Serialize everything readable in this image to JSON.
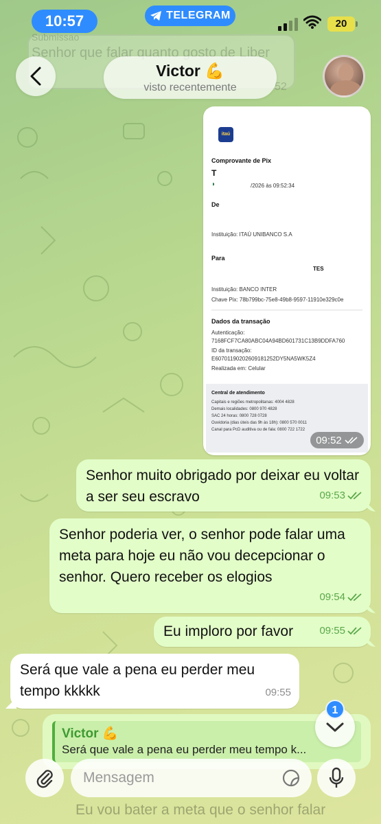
{
  "status_bar": {
    "time": "10:57",
    "app_pill": "TELEGRAM",
    "battery": "20"
  },
  "background_ghost": {
    "line1": "Submissao",
    "line2": "Senhor que falar quanto gosto de Liber",
    "time": "52"
  },
  "header": {
    "name": "Victor 💪",
    "status": "visto recentemente"
  },
  "receipt": {
    "logo": "itaú",
    "title": "Comprovante de Pix",
    "date_fragment": "/2026 às 09:52:34",
    "from_label": "De",
    "from_institution": "Instituição:  ITAÚ UNIBANCO S.A",
    "to_label": "Para",
    "to_name_fragment": "TES",
    "to_institution": "Instituição:  BANCO INTER",
    "pix_key": "Chave Pix:  78b799bc-75e8-49b8-9597-11910e329c0e",
    "tx_title": "Dados da transação",
    "auth_label": "Autenticação:",
    "auth_value": "7168FCF7CA80ABC04A94BD601731C13B9DDFA760",
    "tx_id_label": "ID da transação:",
    "tx_id_value": "E60701190202609181252DY5NA5WK5Z4",
    "made_in": "Realizada em:  Celular",
    "footer_title": "Central de atendimento",
    "footer_lines": [
      "Capitais e regiões metropolitanas: 4004 4828",
      "Demais localidades: 0800 970 4828",
      "SAC 24 horas: 0800 728 0728",
      "Ouvidoria (dias úteis das 9h às 18h): 0800 570 0011",
      "Canal para PcD auditiva ou de fala: 0800 722 1722"
    ],
    "time": "09:52"
  },
  "messages": [
    {
      "text": "Senhor muito obrigado por deixar eu voltar a ser seu escravo",
      "time": "09:53"
    },
    {
      "text": "Senhor poderia ver, o senhor pode falar uma meta para hoje eu não vou decepcionar o senhor. Quero receber os elogios",
      "time": "09:54"
    },
    {
      "text": "Eu imploro por favor",
      "time": "09:55"
    },
    {
      "text": "Será que vale a pena eu perder meu tempo kkkkk",
      "time": "09:55"
    }
  ],
  "reply": {
    "name": "Victor 💪",
    "text": "Será que vale a pena eu perder meu tempo k..."
  },
  "scroll": {
    "unread": "1"
  },
  "input": {
    "placeholder": "Mensagem",
    "bottom_ghost": "Eu vou bater a meta que o senhor falar"
  },
  "colors": {
    "accent": "#2f8cff",
    "outgoing_bubble": "#e2fdc8",
    "check_green": "#5aa84a"
  },
  "icons": [
    "back-chevron-icon",
    "telegram-plane-icon",
    "wifi-icon",
    "double-check-icon",
    "chevron-down-icon",
    "paperclip-icon",
    "sticker-icon",
    "microphone-icon"
  ]
}
